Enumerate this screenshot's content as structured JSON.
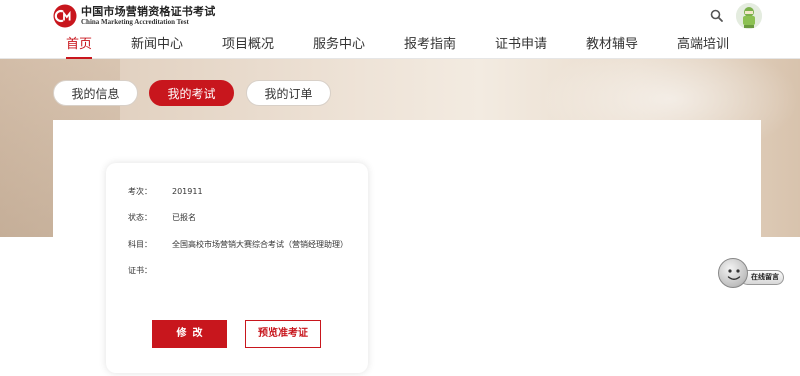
{
  "brand": {
    "name_cn": "中国市场营销资格证书考试",
    "name_en": "China Marketing Accreditation Test",
    "logo_letters": "cm"
  },
  "colors": {
    "accent": "#c8161d"
  },
  "nav": [
    {
      "label": "首页",
      "active": true
    },
    {
      "label": "新闻中心"
    },
    {
      "label": "项目概况"
    },
    {
      "label": "服务中心"
    },
    {
      "label": "报考指南"
    },
    {
      "label": "证书申请"
    },
    {
      "label": "教材辅导"
    },
    {
      "label": "高端培训"
    }
  ],
  "tabs": [
    {
      "label": "我的信息"
    },
    {
      "label": "我的考试",
      "active": true
    },
    {
      "label": "我的订单"
    }
  ],
  "exam": {
    "session_key": "考次：",
    "session_value": "201911",
    "status_key": "状态：",
    "status_value": "已报名",
    "subject_key": "科目：",
    "subject_value": "全国高校市场营销大赛综合考试（营销经理助理）",
    "cert_key": "证书：",
    "cert_value": "",
    "edit_label": "修改",
    "preview_label": "预览准考证"
  },
  "float": {
    "label": "在线留言"
  },
  "icons": {
    "search": "search-icon",
    "avatar": "user-avatar-icon",
    "message": "smiley-face-icon"
  }
}
